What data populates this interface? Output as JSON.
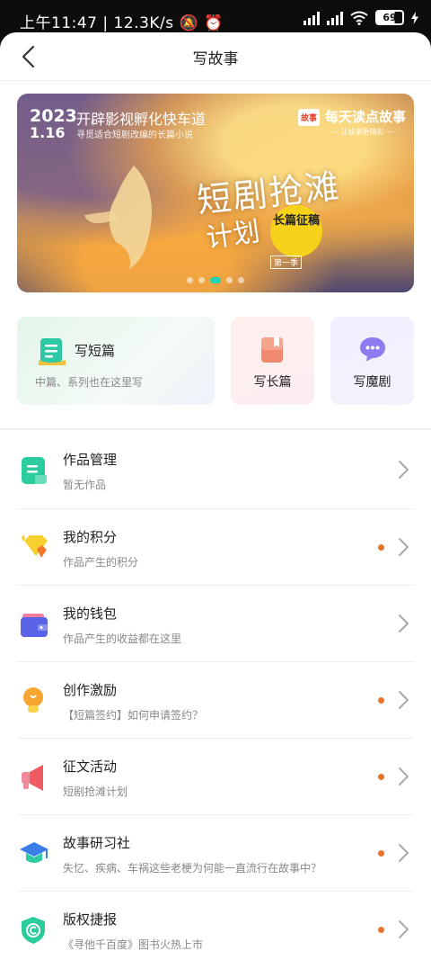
{
  "status_bar": {
    "time": "上午11:47",
    "net_speed": "12.3K/s",
    "battery": "69"
  },
  "header": {
    "title": "写故事"
  },
  "banner": {
    "year": "2023",
    "date": "1.16",
    "headline": "开辟影视孵化快车道",
    "subline": "寻觅适合短剧改编的长篇小说",
    "logo": "故事",
    "brand": "每天读点故事",
    "brand_tagline": "— 让故事更精彩 —",
    "callig_line1": "短剧抢滩",
    "callig_line2": "计划",
    "circle_text": "长篇征稿",
    "season": "第一季",
    "active_page": 3,
    "page_count": 5
  },
  "cards": {
    "short": {
      "title": "写短篇",
      "subtitle": "中篇、系列也在这里写",
      "icon": "document-icon"
    },
    "long": {
      "title": "写长篇",
      "icon": "book-icon"
    },
    "drama": {
      "title": "写魔剧",
      "icon": "chat-bubble-icon"
    }
  },
  "menu": [
    {
      "title": "作品管理",
      "subtitle": "暂无作品",
      "icon": "works-icon",
      "dot": false
    },
    {
      "title": "我的积分",
      "subtitle": "作品产生的积分",
      "icon": "diamond-icon",
      "dot": true
    },
    {
      "title": "我的钱包",
      "subtitle": "作品产生的收益都在这里",
      "icon": "wallet-icon",
      "dot": false
    },
    {
      "title": "创作激励",
      "subtitle": "【短篇签约】如何申请签约？",
      "icon": "bulb-icon",
      "dot": true
    },
    {
      "title": "征文活动",
      "subtitle": "短剧抢滩计划",
      "icon": "megaphone-icon",
      "dot": true
    },
    {
      "title": "故事研习社",
      "subtitle": "失忆、疾病、车祸这些老梗为何能一直流行在故事中？",
      "icon": "graduation-cap-icon",
      "dot": true
    },
    {
      "title": "版权捷报",
      "subtitle": "《寻他千百度》图书火热上市",
      "icon": "copyright-shield-icon",
      "dot": true
    }
  ],
  "colors": {
    "accent_teal": "#1fd3b2",
    "notify_dot": "#e8732a"
  }
}
